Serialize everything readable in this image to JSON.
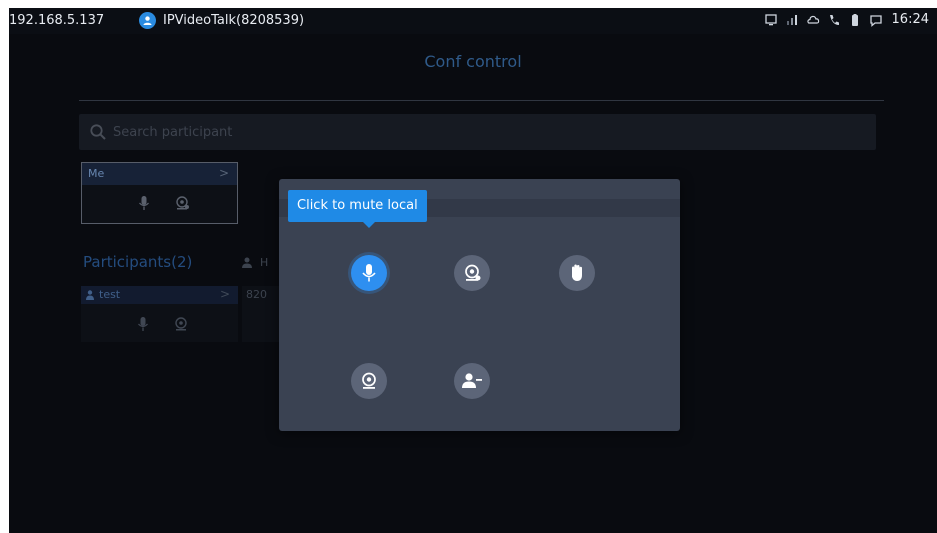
{
  "status_bar": {
    "ip": "192.168.5.137",
    "app_title": "IPVideoTalk(8208539)",
    "time": "16:24",
    "icons": [
      "screen-icon",
      "signal-icon",
      "cloud-icon",
      "phone-icon",
      "battery-icon",
      "chat-icon"
    ]
  },
  "page": {
    "title": "Conf control"
  },
  "search": {
    "placeholder": "Search participant"
  },
  "me_card": {
    "label": "Me",
    "chevron": ">"
  },
  "participants": {
    "title": "Participants(2)",
    "host_text": "H",
    "items": [
      {
        "name": "test",
        "chevron": ">"
      },
      {
        "name": "820"
      }
    ]
  },
  "dialog": {
    "tooltip": "Click to mute local",
    "actions": [
      {
        "icon": "microphone-icon",
        "active": true
      },
      {
        "icon": "camera-icon"
      },
      {
        "icon": "raise-hand-icon"
      },
      {
        "icon": "webcam-icon"
      },
      {
        "icon": "remove-user-icon"
      }
    ]
  },
  "colors": {
    "accent": "#2e8ff0",
    "background": "#0b0e14",
    "dialog": "#3a4252",
    "title": "#3a6ea8"
  }
}
